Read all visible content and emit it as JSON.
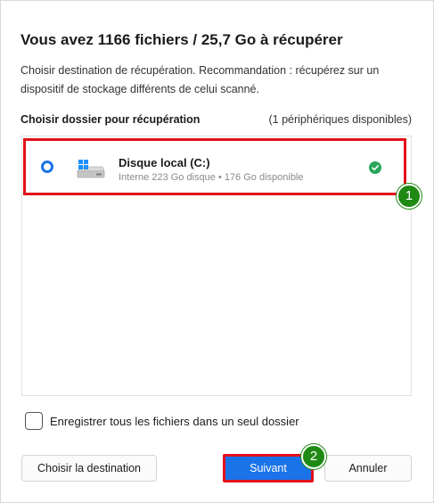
{
  "dialog": {
    "title": "Vous avez 1166 fichiers / 25,7 Go à récupérer",
    "description": "Choisir destination de récupération. Recommandation : récupérez sur un dispositif de stockage différents de celui scanné."
  },
  "section": {
    "label": "Choisir dossier pour récupération",
    "count": "(1 périphériques disponibles)"
  },
  "drives": [
    {
      "name": "Disque local (C:)",
      "info": "Interne 223 Go disque • 176 Go disponible",
      "icon": "windows-drive-icon",
      "status_icon": "check-circle-icon",
      "selected": false
    }
  ],
  "badges": {
    "first": "1",
    "second": "2"
  },
  "options": {
    "single_folder_label": "Enregistrer tous les fichiers dans un seul dossier",
    "single_folder_checked": false
  },
  "buttons": {
    "choose_destination": "Choisir la destination",
    "next": "Suivant",
    "cancel": "Annuler"
  },
  "colors": {
    "accent": "#1a73e8",
    "highlight": "#e3101b",
    "badge": "#1e8a13",
    "success": "#2aa55a"
  }
}
